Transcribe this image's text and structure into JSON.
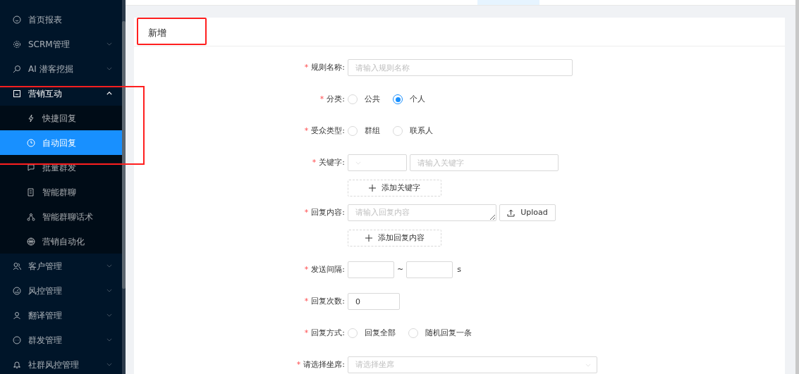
{
  "sidebar": {
    "items": [
      {
        "label": "首页报表"
      },
      {
        "label": "SCRM管理",
        "expanded": false
      },
      {
        "label": "AI 潜客挖掘",
        "expanded": false
      },
      {
        "label": "营销互动",
        "expanded": true,
        "children": [
          {
            "label": "快捷回复",
            "selected": false
          },
          {
            "label": "自动回复",
            "selected": true
          },
          {
            "label": "批量群发",
            "selected": false
          },
          {
            "label": "智能群聊",
            "selected": false
          },
          {
            "label": "智能群聊话术",
            "selected": false
          },
          {
            "label": "营销自动化",
            "selected": false
          }
        ]
      },
      {
        "label": "客户管理",
        "expanded": false
      },
      {
        "label": "风控管理",
        "expanded": false
      },
      {
        "label": "翻译管理",
        "expanded": false
      },
      {
        "label": "群发管理",
        "expanded": false
      },
      {
        "label": "社群风控管理",
        "expanded": false
      }
    ]
  },
  "card": {
    "title": "新增",
    "form": [
      {
        "kind": "input",
        "required_mark": "*",
        "label": "规则名称:",
        "placeholder": "请输入规则名称"
      },
      {
        "kind": "radio",
        "required_mark": "*",
        "label": "分类:",
        "options": [
          {
            "label": "公共",
            "selected": false
          },
          {
            "label": "个人",
            "selected": true
          }
        ]
      },
      {
        "kind": "radio",
        "required_mark": "*",
        "label": "受众类型:",
        "options": [
          {
            "label": "群组",
            "selected": false
          },
          {
            "label": "联系人",
            "selected": false
          }
        ]
      },
      {
        "kind": "keyword",
        "required_mark": "*",
        "label": "关键字:",
        "placeholder": "请输入关键字",
        "add_button": "添加关键字"
      },
      {
        "kind": "content",
        "required_mark": "*",
        "label": "回复内容:",
        "placeholder": "请输入回复内容",
        "upload_button": "Upload",
        "add_button": "添加回复内容"
      },
      {
        "kind": "range",
        "required_mark": "*",
        "label": "发送间隔:",
        "separator": "~",
        "unit": "s"
      },
      {
        "kind": "number",
        "required_mark": "*",
        "label": "回复次数:",
        "value": "0"
      },
      {
        "kind": "radio",
        "required_mark": "*",
        "label": "回复方式:",
        "options": [
          {
            "label": "回复全部",
            "selected": false
          },
          {
            "label": "随机回复一条",
            "selected": false
          }
        ]
      },
      {
        "kind": "select",
        "required_mark": "*",
        "label": "请选择坐席:",
        "placeholder": "请选择坐席"
      }
    ]
  },
  "annotations": {
    "card_title_outlined": true,
    "menu_group_outlined": true
  }
}
